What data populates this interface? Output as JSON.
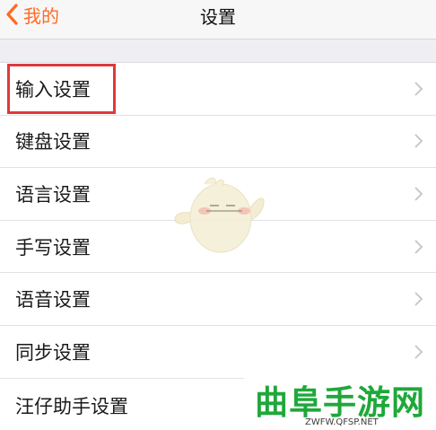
{
  "nav": {
    "back_label": "我的",
    "title": "设置"
  },
  "settings_items": [
    {
      "label": "输入设置"
    },
    {
      "label": "键盘设置"
    },
    {
      "label": "语言设置"
    },
    {
      "label": "手写设置"
    },
    {
      "label": "语音设置"
    },
    {
      "label": "同步设置"
    },
    {
      "label": "汪仔助手设置"
    }
  ],
  "watermark": {
    "main": "曲阜手游网",
    "sub": "ZWFW.QFSP.NET"
  },
  "colors": {
    "accent": "#ff6a22",
    "highlight_box": "#e0393c",
    "watermark_green": "#1fa83a"
  }
}
